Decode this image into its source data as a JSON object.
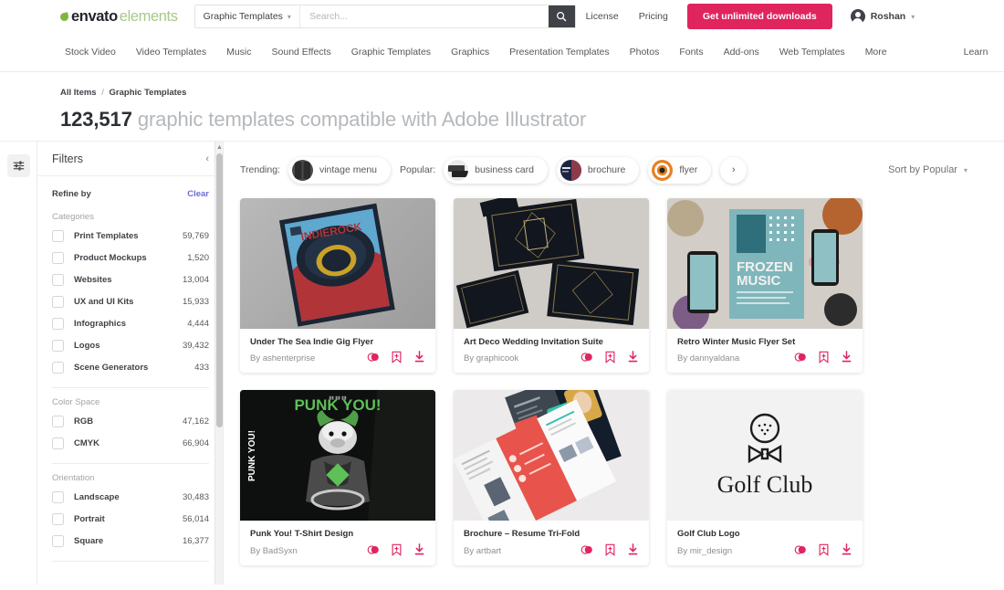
{
  "header": {
    "logo": {
      "part1": "envato",
      "part2": "elements",
      "icon": "leaf-icon"
    },
    "search": {
      "category": "Graphic Templates",
      "placeholder": "Search...",
      "value": "",
      "button_icon": "search-icon"
    },
    "links": [
      {
        "label": "License"
      },
      {
        "label": "Pricing"
      }
    ],
    "cta_label": "Get unlimited downloads",
    "account": {
      "name": "Roshan",
      "icon": "user-avatar-icon",
      "caret": "chevron-down-icon"
    },
    "accent_color": "#e0245e"
  },
  "nav": {
    "items": [
      {
        "label": "Stock Video"
      },
      {
        "label": "Video Templates"
      },
      {
        "label": "Music"
      },
      {
        "label": "Sound Effects"
      },
      {
        "label": "Graphic Templates"
      },
      {
        "label": "Graphics"
      },
      {
        "label": "Presentation Templates"
      },
      {
        "label": "Photos"
      },
      {
        "label": "Fonts"
      },
      {
        "label": "Add-ons"
      },
      {
        "label": "Web Templates"
      },
      {
        "label": "More"
      }
    ],
    "learn_label": "Learn"
  },
  "page": {
    "breadcrumb": {
      "root": "All Items",
      "separator": "/",
      "current": "Graphic Templates"
    },
    "title_count": "123,517",
    "title_rest": "graphic templates compatible with Adobe Illustrator"
  },
  "filters": {
    "rail_icon": "filter-sliders-icon",
    "panel_title": "Filters",
    "collapse_icon": "chevron-left-icon",
    "refine_label": "Refine by",
    "clear_label": "Clear",
    "groups": [
      {
        "title": "Categories",
        "items": [
          {
            "label": "Print Templates",
            "count": "59,769"
          },
          {
            "label": "Product Mockups",
            "count": "1,520"
          },
          {
            "label": "Websites",
            "count": "13,004"
          },
          {
            "label": "UX and UI Kits",
            "count": "15,933"
          },
          {
            "label": "Infographics",
            "count": "4,444"
          },
          {
            "label": "Logos",
            "count": "39,432"
          },
          {
            "label": "Scene Generators",
            "count": "433"
          }
        ]
      },
      {
        "title": "Color Space",
        "items": [
          {
            "label": "RGB",
            "count": "47,162"
          },
          {
            "label": "CMYK",
            "count": "66,904"
          }
        ]
      },
      {
        "title": "Orientation",
        "items": [
          {
            "label": "Landscape",
            "count": "30,483"
          },
          {
            "label": "Portrait",
            "count": "56,014"
          },
          {
            "label": "Square",
            "count": "16,377"
          }
        ]
      }
    ]
  },
  "chips": {
    "trending_label": "Trending:",
    "popular_label": "Popular:",
    "items": [
      {
        "label": "vintage menu",
        "thumb": "vintage-menu-thumb"
      },
      {
        "label": "business card",
        "thumb": "business-card-thumb"
      },
      {
        "label": "brochure",
        "thumb": "brochure-thumb"
      },
      {
        "label": "flyer",
        "thumb": "flyer-thumb"
      }
    ],
    "next_icon": "chevron-right-icon"
  },
  "sort": {
    "label": "Sort by Popular",
    "icon": "chevron-down-icon"
  },
  "card_actions": [
    {
      "name": "color-palette-icon",
      "label": "Similar colors"
    },
    {
      "name": "bookmark-add-icon",
      "label": "Add to collection"
    },
    {
      "name": "download-icon",
      "label": "Download"
    }
  ],
  "results": [
    {
      "title": "Under The Sea Indie Gig Flyer",
      "author": "By ashenterprise",
      "art": "gig-flyer"
    },
    {
      "title": "Art Deco Wedding Invitation Suite",
      "author": "By graphicook",
      "art": "art-deco"
    },
    {
      "title": "Retro Winter Music Flyer Set",
      "author": "By dannyaldana",
      "art": "frozen-music"
    },
    {
      "title": "Punk You! T-Shirt Design",
      "author": "By BadSyxn",
      "art": "punk-you"
    },
    {
      "title": "Brochure – Resume Tri-Fold",
      "author": "By artbart",
      "art": "tri-fold"
    },
    {
      "title": "Golf Club Logo",
      "author": "By mir_design",
      "art": "golf-club"
    }
  ]
}
